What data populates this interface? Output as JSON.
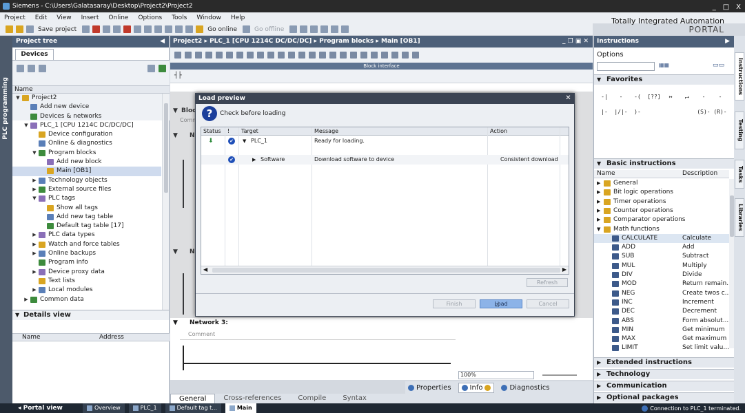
{
  "window": {
    "title": "Siemens  -  C:\\Users\\Galatasaray\\Desktop\\Project2\\Project2",
    "controls": [
      "_",
      "□",
      "X"
    ]
  },
  "menu": [
    "Project",
    "Edit",
    "View",
    "Insert",
    "Online",
    "Options",
    "Tools",
    "Window",
    "Help"
  ],
  "brand": {
    "line1": "Totally Integrated Automation",
    "line2": "PORTAL"
  },
  "toolbar": {
    "save_label": "Save project",
    "go_online": "Go online",
    "go_offline": "Go offline"
  },
  "left_strip": {
    "label": "PLC programming"
  },
  "project_tree": {
    "title": "Project tree",
    "tab": "Devices",
    "column_name": "Name",
    "items": [
      {
        "label": "Project2",
        "depth": 0,
        "arrow": "▼"
      },
      {
        "label": "Add new device",
        "depth": 1,
        "arrow": ""
      },
      {
        "label": "Devices & networks",
        "depth": 1,
        "arrow": ""
      },
      {
        "label": "PLC_1 [CPU 1214C DC/DC/DC]",
        "depth": 1,
        "arrow": "▼"
      },
      {
        "label": "Device configuration",
        "depth": 2,
        "arrow": ""
      },
      {
        "label": "Online & diagnostics",
        "depth": 2,
        "arrow": ""
      },
      {
        "label": "Program blocks",
        "depth": 2,
        "arrow": "▼"
      },
      {
        "label": "Add new block",
        "depth": 3,
        "arrow": ""
      },
      {
        "label": "Main [OB1]",
        "depth": 3,
        "arrow": "",
        "selected": true
      },
      {
        "label": "Technology objects",
        "depth": 2,
        "arrow": "▶"
      },
      {
        "label": "External source files",
        "depth": 2,
        "arrow": "▶"
      },
      {
        "label": "PLC tags",
        "depth": 2,
        "arrow": "▼"
      },
      {
        "label": "Show all tags",
        "depth": 3,
        "arrow": ""
      },
      {
        "label": "Add new tag table",
        "depth": 3,
        "arrow": ""
      },
      {
        "label": "Default tag table [17]",
        "depth": 3,
        "arrow": ""
      },
      {
        "label": "PLC data types",
        "depth": 2,
        "arrow": "▶"
      },
      {
        "label": "Watch and force tables",
        "depth": 2,
        "arrow": "▶"
      },
      {
        "label": "Online backups",
        "depth": 2,
        "arrow": "▶"
      },
      {
        "label": "Program info",
        "depth": 2,
        "arrow": ""
      },
      {
        "label": "Device proxy data",
        "depth": 2,
        "arrow": "▶"
      },
      {
        "label": "Text lists",
        "depth": 2,
        "arrow": ""
      },
      {
        "label": "Local modules",
        "depth": 2,
        "arrow": "▶"
      },
      {
        "label": "Common data",
        "depth": 1,
        "arrow": "▶"
      }
    ]
  },
  "details_view": {
    "title": "Details view",
    "col_name": "Name",
    "col_address": "Address"
  },
  "editor": {
    "breadcrumb": "Project2  ▸  PLC_1 [CPU 1214C DC/DC/DC]  ▸  Program blocks  ▸  Main [OB1]",
    "block_interface": "Block interface",
    "block_title": "Block",
    "comment_short": "Comm",
    "network_n": "N",
    "network3": "Network 3:",
    "comment": "Comment",
    "zoom": "100%"
  },
  "dialog": {
    "title": "Load preview",
    "check_text": "Check before loading",
    "columns": {
      "status": "Status",
      "exclam": "!",
      "target": "Target",
      "message": "Message",
      "action": "Action"
    },
    "rows": [
      {
        "target": "PLC_1",
        "message": "Ready for loading.",
        "action": ""
      },
      {
        "target": "Software",
        "message": "Download software to device",
        "action": "Consistent download"
      }
    ],
    "refresh": "Refresh",
    "finish": "Finish",
    "load": "Load",
    "cancel": "Cancel"
  },
  "properties_tabs": {
    "properties": "Properties",
    "info": "Info",
    "diagnostics": "Diagnostics"
  },
  "general_tabs": [
    "General",
    "Cross-references",
    "Compile",
    "Syntax"
  ],
  "instructions": {
    "title": "Instructions",
    "options": "Options",
    "favorites": "Favorites",
    "favorite_items": [
      "-| |-",
      "-|/|-",
      "-( )-",
      "[??]",
      "↦",
      "⮣",
      "-(S)-",
      "-(R)-"
    ],
    "basic": "Basic instructions",
    "col_name": "Name",
    "col_desc": "Description",
    "items": [
      {
        "name": "General",
        "desc": "",
        "folder": true,
        "arrow": "▶"
      },
      {
        "name": "Bit logic operations",
        "desc": "",
        "folder": true,
        "arrow": "▶"
      },
      {
        "name": "Timer operations",
        "desc": "",
        "folder": true,
        "arrow": "▶"
      },
      {
        "name": "Counter operations",
        "desc": "",
        "folder": true,
        "arrow": "▶"
      },
      {
        "name": "Comparator operations",
        "desc": "",
        "folder": true,
        "arrow": "▶"
      },
      {
        "name": "Math functions",
        "desc": "",
        "folder": true,
        "arrow": "▼"
      },
      {
        "name": "CALCULATE",
        "desc": "Calculate",
        "folder": false,
        "selected": true
      },
      {
        "name": "ADD",
        "desc": "Add",
        "folder": false
      },
      {
        "name": "SUB",
        "desc": "Subtract",
        "folder": false
      },
      {
        "name": "MUL",
        "desc": "Multiply",
        "folder": false
      },
      {
        "name": "DIV",
        "desc": "Divide",
        "folder": false
      },
      {
        "name": "MOD",
        "desc": "Return remain...",
        "folder": false
      },
      {
        "name": "NEG",
        "desc": "Create twos c...",
        "folder": false
      },
      {
        "name": "INC",
        "desc": "Increment",
        "folder": false
      },
      {
        "name": "DEC",
        "desc": "Decrement",
        "folder": false
      },
      {
        "name": "ABS",
        "desc": "Form absolut...",
        "folder": false
      },
      {
        "name": "MIN",
        "desc": "Get minimum",
        "folder": false
      },
      {
        "name": "MAX",
        "desc": "Get maximum",
        "folder": false
      },
      {
        "name": "LIMIT",
        "desc": "Set limit valu...",
        "folder": false
      }
    ],
    "extended": "Extended instructions",
    "technology": "Technology",
    "communication": "Communication",
    "optional": "Optional packages"
  },
  "right_tabs": [
    "Instructions",
    "Testing",
    "Tasks",
    "Libraries"
  ],
  "statusbar": {
    "portal_view": "Portal view",
    "tabs": [
      "Overview",
      "PLC_1",
      "Default tag t...",
      "Main"
    ],
    "connection": "Connection to PLC_1 terminated."
  }
}
